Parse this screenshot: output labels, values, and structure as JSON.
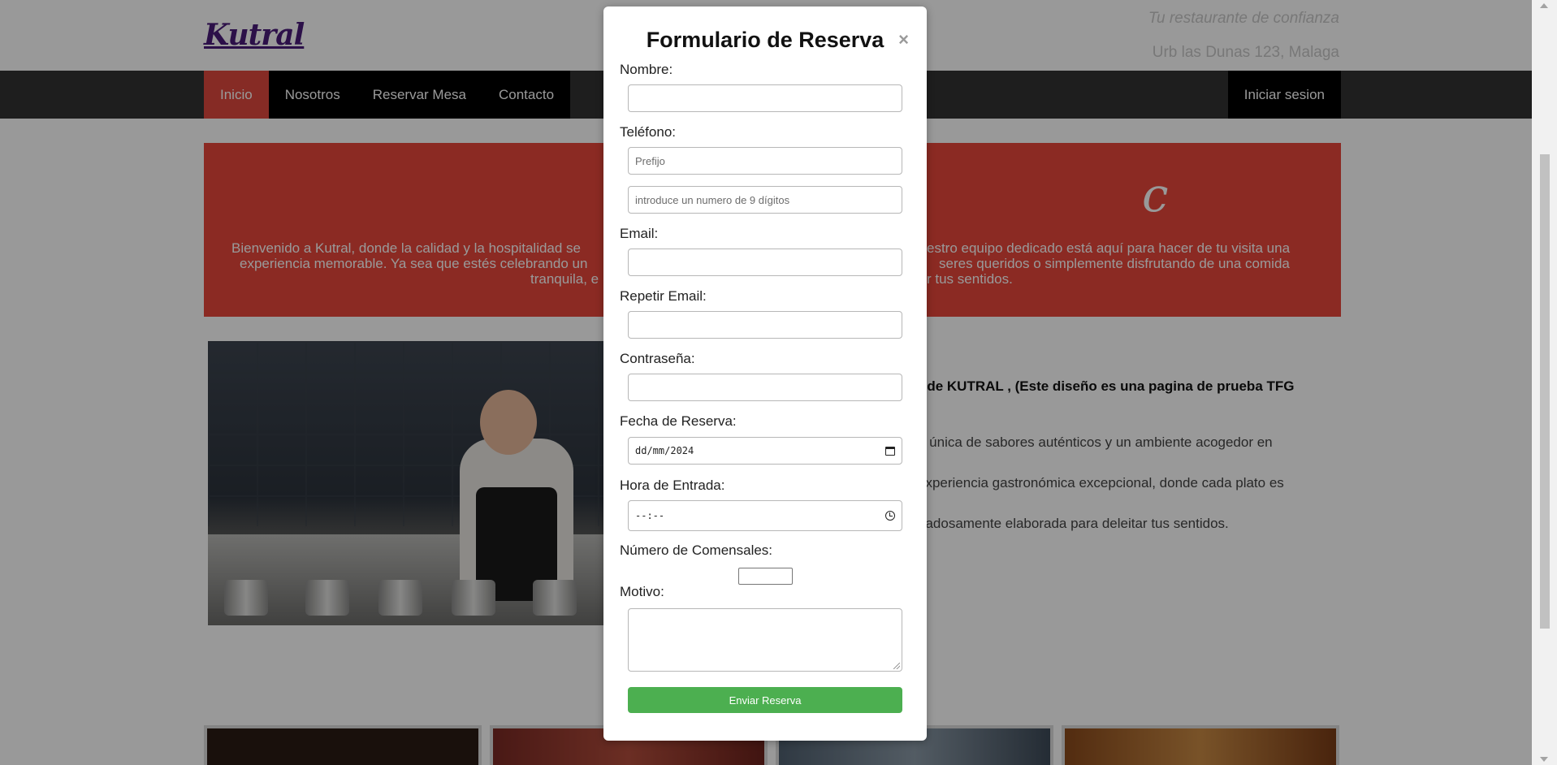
{
  "header": {
    "logo": "Kutral",
    "tagline": "Tu restaurante de confianza",
    "address": "Urb las Dunas 123, Malaga"
  },
  "nav": {
    "items": [
      "Inicio",
      "Nosotros",
      "Reservar Mesa",
      "Contacto"
    ],
    "active": "Inicio",
    "login": "Iniciar sesion"
  },
  "hero": {
    "title_fragment": "c",
    "text_line1_left": "Bienvenido a Kutral, donde la calidad y la hospitalidad se",
    "text_line1_right": "estro equipo dedicado está aquí para hacer de tu visita una",
    "text_line2_left": "experiencia memorable. Ya sea que estés celebrando un",
    "text_line2_right": "seres queridos o simplemente disfrutando de una comida",
    "text_line3_left": "tranquila, e",
    "text_line3_right": "r tus sentidos."
  },
  "intro": {
    "heading_fragment": "r de KUTRAL , (Este diseño es una pagina de prueba TFG",
    "p1": "n única de sabores auténticos y un ambiente acogedor en",
    "p2": "experiencia gastronómica excepcional, donde cada plato es",
    "p3": "dadosamente elaborada para deleitar tus sentidos."
  },
  "modal": {
    "title": "Formulario de Reserva",
    "close": "×",
    "fields": {
      "nombre_label": "Nombre:",
      "telefono_label": "Teléfono:",
      "prefijo_placeholder": "Prefijo",
      "numero_placeholder": "introduce un numero de 9 dígitos",
      "email_label": "Email:",
      "repetir_email_label": "Repetir Email:",
      "password_label": "Contraseña:",
      "fecha_label": "Fecha de Reserva:",
      "fecha_value": "dd/mm/2024",
      "hora_label": "Hora de Entrada:",
      "hora_value": "--:--",
      "comensales_label": "Número de Comensales:",
      "motivo_label": "Motivo:"
    },
    "submit": "Enviar Reserva"
  },
  "colors": {
    "accent_red": "#e8473b",
    "nav_bg": "#333333",
    "submit_green": "#4caf50",
    "logo_purple": "#4a1b7a"
  }
}
